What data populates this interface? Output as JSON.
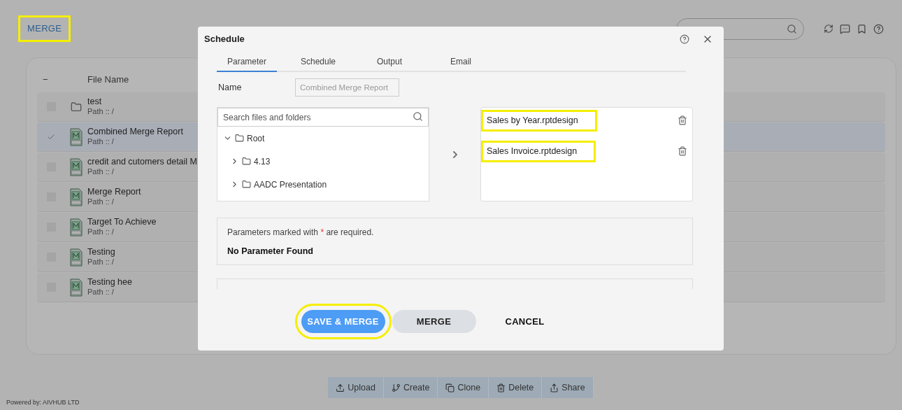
{
  "page": {
    "title": "MERGE",
    "title_highlighted": true,
    "footer": "Powered by: AIVHUB LTD"
  },
  "file_table": {
    "select_all": "−",
    "columns": [
      "File Name"
    ],
    "rows": [
      {
        "kind": "folder",
        "name": "test",
        "path": "Path :: /",
        "selected": false
      },
      {
        "kind": "report",
        "name": "Combined Merge Report",
        "path": "Path :: /",
        "selected": true
      },
      {
        "kind": "report",
        "name": "credit and cutomers detail M",
        "path": "Path :: /",
        "selected": false
      },
      {
        "kind": "report",
        "name": "Merge Report",
        "path": "Path :: /",
        "selected": false
      },
      {
        "kind": "report",
        "name": "Target To Achieve",
        "path": "Path :: /",
        "selected": false
      },
      {
        "kind": "report",
        "name": "Testing",
        "path": "Path :: /",
        "selected": false
      },
      {
        "kind": "report",
        "name": "Testing hee",
        "path": "Path :: /",
        "selected": false
      }
    ]
  },
  "toolbar": [
    {
      "kind": "upload",
      "label": "Upload"
    },
    {
      "kind": "create",
      "label": "Create"
    },
    {
      "kind": "clone",
      "label": "Clone"
    },
    {
      "kind": "delete",
      "label": "Delete"
    },
    {
      "kind": "share",
      "label": "Share"
    }
  ],
  "dialog": {
    "title": "Schedule",
    "tabs": [
      {
        "label": "Parameter",
        "selected": true
      },
      {
        "label": "Schedule",
        "selected": false
      },
      {
        "label": "Output",
        "selected": false
      },
      {
        "label": "Email",
        "selected": false
      }
    ],
    "name_label": "Name",
    "name_value": "Combined Merge Report",
    "tree_search": {
      "placeholder": "Search files and folders"
    },
    "tree": [
      {
        "label": "Root",
        "expanded": true,
        "children": [
          {
            "label": "4.13",
            "expanded": false
          },
          {
            "label": "AADC Presentation",
            "expanded": false
          }
        ]
      }
    ],
    "selected_files": [
      {
        "name": "Sales by Year.rptdesign",
        "highlighted": true
      },
      {
        "name": "Sales Invoice.rptdesign",
        "highlighted": true
      }
    ],
    "parameters_note_pre": "Parameters marked with ",
    "parameters_note_star": "*",
    "parameters_note_post": " are required.",
    "parameters_empty": "No Parameter Found",
    "buttons": [
      {
        "kind": "primary",
        "label": "SAVE & MERGE",
        "highlighted": true
      },
      {
        "kind": "secondary",
        "label": "MERGE"
      },
      {
        "kind": "text",
        "label": "CANCEL"
      }
    ]
  }
}
